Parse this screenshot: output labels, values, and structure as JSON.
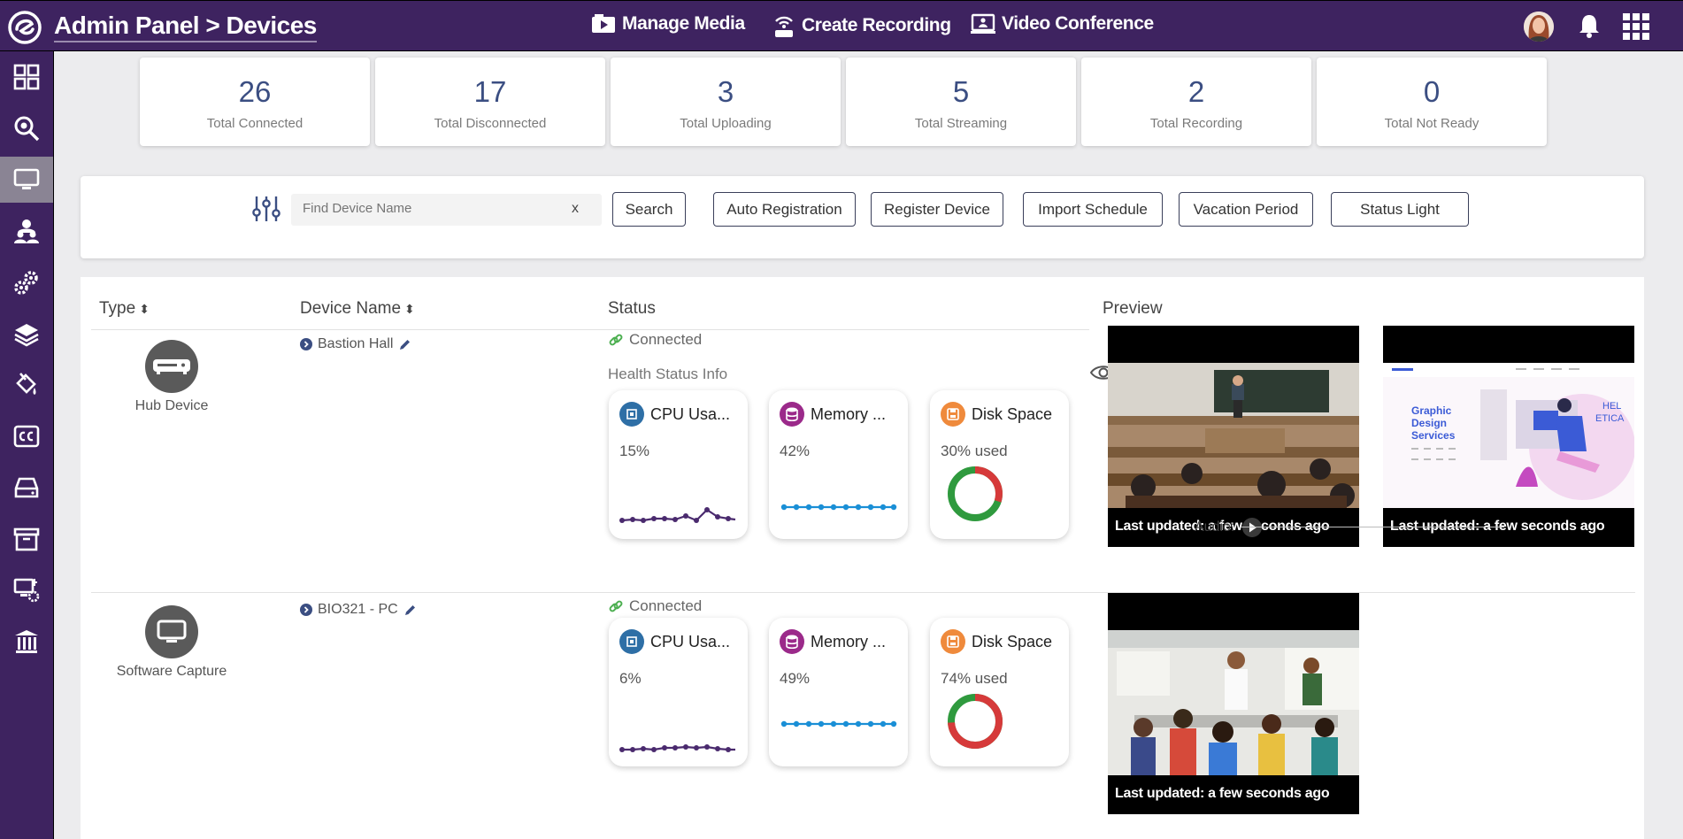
{
  "header": {
    "title": "Admin Panel > Devices",
    "nav": [
      {
        "label": "Manage Media",
        "icon": "media-icon"
      },
      {
        "label": "Create Recording",
        "icon": "recording-icon"
      },
      {
        "label": "Video Conference",
        "icon": "conference-icon"
      }
    ],
    "icons": [
      "avatar",
      "bell-icon",
      "apps-grid-icon"
    ]
  },
  "sidebar": {
    "items": [
      {
        "icon": "dashboard-icon",
        "active": false
      },
      {
        "icon": "search-icon",
        "active": false
      },
      {
        "icon": "monitor-icon",
        "active": true
      },
      {
        "icon": "users-icon",
        "active": false
      },
      {
        "icon": "gears-icon",
        "active": false
      },
      {
        "icon": "layers-icon",
        "active": false
      },
      {
        "icon": "paint-bucket-icon",
        "active": false
      },
      {
        "icon": "closed-caption-icon",
        "active": false
      },
      {
        "icon": "drive-icon",
        "active": false
      },
      {
        "icon": "archive-icon",
        "active": false
      },
      {
        "icon": "device-settings-icon",
        "active": false
      },
      {
        "icon": "building-icon",
        "active": false
      }
    ]
  },
  "stats": [
    {
      "value": "26",
      "label": "Total Connected"
    },
    {
      "value": "17",
      "label": "Total Disconnected"
    },
    {
      "value": "3",
      "label": "Total Uploading"
    },
    {
      "value": "5",
      "label": "Total Streaming"
    },
    {
      "value": "2",
      "label": "Total Recording"
    },
    {
      "value": "0",
      "label": "Total Not Ready"
    }
  ],
  "toolbar": {
    "search_placeholder": "Find Device Name",
    "clear_label": "x",
    "buttons": [
      "Search",
      "Auto Registration",
      "Register Device",
      "Import Schedule",
      "Vacation Period",
      "Status Light"
    ]
  },
  "table": {
    "headers": {
      "type": "Type",
      "name": "Device Name",
      "status": "Status",
      "preview": "Preview"
    },
    "rows": [
      {
        "type": "Hub Device",
        "name": "Bastion Hall",
        "status": "Connected",
        "health_label": "Health Status Info",
        "cards": {
          "cpu": {
            "title": "CPU Usa...",
            "value": "15%"
          },
          "memory": {
            "title": "Memory ...",
            "value": "42%"
          },
          "disk": {
            "title": "Disk Space",
            "value": "30% used",
            "used_fraction": 0.3
          }
        },
        "previews": [
          {
            "caption": "Last updated: a few seconds ago"
          },
          {
            "caption": "Last updated: a few seconds ago",
            "slide_text": "Graphic Design Services"
          }
        ],
        "audio_label": "Audio:"
      },
      {
        "type": "Software Capture",
        "name": "BIO321 - PC",
        "status": "Connected",
        "cards": {
          "cpu": {
            "title": "CPU Usa...",
            "value": "6%"
          },
          "memory": {
            "title": "Memory ...",
            "value": "49%"
          },
          "disk": {
            "title": "Disk Space",
            "value": "74% used",
            "used_fraction": 0.74
          }
        },
        "previews": [
          {
            "caption": "Last updated: a few seconds ago"
          }
        ]
      }
    ]
  },
  "colors": {
    "header_bg": "#3e2360",
    "accent_blue": "#3b4e82",
    "spark_purple": "#4a2a6e",
    "spark_blue": "#1a8fd6",
    "disk_used": "#d63a3a",
    "disk_free": "#2f9a3e"
  }
}
